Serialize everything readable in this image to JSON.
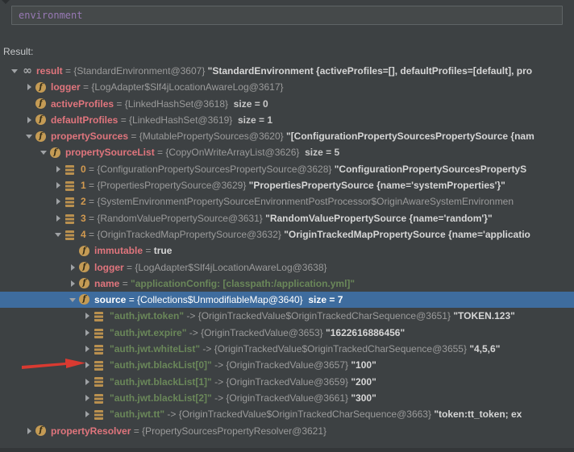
{
  "expression_bar": {
    "value": "environment"
  },
  "result_label": "Result:",
  "colors": {
    "background": "#3d4143",
    "selection_blue": "#3e6c9e",
    "variable_name_red": "#e0757d",
    "reference_gray": "#9b9b9b",
    "value_white": "#d6d6d6",
    "string_green": "#6a8759",
    "index_gold": "#d29a50",
    "field_icon_gold": "#c49b55",
    "array_icon_tan": "#b9904f",
    "annotation_arrow_red": "#d93a31",
    "input_text_purple": "#9879b5"
  },
  "annotation": {
    "type": "red-arrow",
    "points_at": "auth.jwt.blackList[0] row"
  },
  "tree": {
    "rows": [
      {
        "level": 0,
        "expander": "down",
        "icon": "watch",
        "selected": false,
        "segments": [
          {
            "s": "name",
            "t": "result"
          },
          {
            "s": "ref",
            "t": " = {StandardEnvironment@3607} "
          },
          {
            "s": "value",
            "t": "\"StandardEnvironment {activeProfiles=[], defaultProfiles=[default], pro"
          }
        ]
      },
      {
        "level": 1,
        "expander": "right",
        "icon": "field",
        "selected": false,
        "segments": [
          {
            "s": "name",
            "t": "logger"
          },
          {
            "s": "ref",
            "t": " = {LogAdapter$Slf4jLocationAwareLog@3617}"
          }
        ]
      },
      {
        "level": 1,
        "expander": null,
        "icon": "field",
        "selected": false,
        "segments": [
          {
            "s": "name",
            "t": "activeProfiles"
          },
          {
            "s": "ref",
            "t": " = {LinkedHashSet@3618}"
          },
          {
            "s": "size",
            "t": "  size = 0"
          }
        ]
      },
      {
        "level": 1,
        "expander": "right",
        "icon": "field",
        "selected": false,
        "segments": [
          {
            "s": "name",
            "t": "defaultProfiles"
          },
          {
            "s": "ref",
            "t": " = {LinkedHashSet@3619}"
          },
          {
            "s": "size",
            "t": "  size = 1"
          }
        ]
      },
      {
        "level": 1,
        "expander": "down",
        "icon": "field",
        "selected": false,
        "segments": [
          {
            "s": "name",
            "t": "propertySources"
          },
          {
            "s": "ref",
            "t": " = {MutablePropertySources@3620} "
          },
          {
            "s": "value",
            "t": "\"[ConfigurationPropertySourcesPropertySource {nam"
          }
        ]
      },
      {
        "level": 2,
        "expander": "down",
        "icon": "field",
        "selected": false,
        "segments": [
          {
            "s": "name",
            "t": "propertySourceList"
          },
          {
            "s": "ref",
            "t": " = {CopyOnWriteArrayList@3626}"
          },
          {
            "s": "size",
            "t": "  size = 5"
          }
        ]
      },
      {
        "level": 3,
        "expander": "right",
        "icon": "array",
        "selected": false,
        "segments": [
          {
            "s": "index",
            "t": "0"
          },
          {
            "s": "ref",
            "t": " = {ConfigurationPropertySourcesPropertySource@3628} "
          },
          {
            "s": "value",
            "t": "\"ConfigurationPropertySourcesPropertyS"
          }
        ]
      },
      {
        "level": 3,
        "expander": "right",
        "icon": "array",
        "selected": false,
        "segments": [
          {
            "s": "index",
            "t": "1"
          },
          {
            "s": "ref",
            "t": " = {PropertiesPropertySource@3629} "
          },
          {
            "s": "value",
            "t": "\"PropertiesPropertySource {name='systemProperties'}\""
          }
        ]
      },
      {
        "level": 3,
        "expander": "right",
        "icon": "array",
        "selected": false,
        "segments": [
          {
            "s": "index",
            "t": "2"
          },
          {
            "s": "ref",
            "t": " = {SystemEnvironmentPropertySourceEnvironmentPostProcessor$OriginAwareSystemEnvironmen"
          }
        ]
      },
      {
        "level": 3,
        "expander": "right",
        "icon": "array",
        "selected": false,
        "segments": [
          {
            "s": "index",
            "t": "3"
          },
          {
            "s": "ref",
            "t": " = {RandomValuePropertySource@3631} "
          },
          {
            "s": "value",
            "t": "\"RandomValuePropertySource {name='random'}\""
          }
        ]
      },
      {
        "level": 3,
        "expander": "down",
        "icon": "array",
        "selected": false,
        "segments": [
          {
            "s": "index",
            "t": "4"
          },
          {
            "s": "ref",
            "t": " = {OriginTrackedMapPropertySource@3632} "
          },
          {
            "s": "value",
            "t": "\"OriginTrackedMapPropertySource {name='applicatio"
          }
        ]
      },
      {
        "level": 4,
        "expander": null,
        "icon": "field",
        "selected": false,
        "segments": [
          {
            "s": "name",
            "t": "immutable"
          },
          {
            "s": "ref",
            "t": " = "
          },
          {
            "s": "value",
            "t": "true"
          }
        ]
      },
      {
        "level": 4,
        "expander": "right",
        "icon": "field",
        "selected": false,
        "segments": [
          {
            "s": "name",
            "t": "logger"
          },
          {
            "s": "ref",
            "t": " = {LogAdapter$Slf4jLocationAwareLog@3638}"
          }
        ]
      },
      {
        "level": 4,
        "expander": "right",
        "icon": "field",
        "selected": false,
        "segments": [
          {
            "s": "name",
            "t": "name"
          },
          {
            "s": "ref",
            "t": " = "
          },
          {
            "s": "string",
            "t": "\"applicationConfig: [classpath:/application.yml]\""
          }
        ]
      },
      {
        "level": 4,
        "expander": "down",
        "icon": "field",
        "selected": true,
        "segments": [
          {
            "s": "name",
            "t": "source"
          },
          {
            "s": "ref",
            "t": " = {Collections$UnmodifiableMap@3640}"
          },
          {
            "s": "size",
            "t": "  size = 7"
          }
        ]
      },
      {
        "level": 5,
        "expander": "right",
        "icon": "array",
        "selected": false,
        "segments": [
          {
            "s": "string",
            "t": "\"auth.jwt.token\""
          },
          {
            "s": "ref",
            "t": " -> {OriginTrackedValue$OriginTrackedCharSequence@3651} "
          },
          {
            "s": "value",
            "t": "\"TOKEN.123\""
          }
        ]
      },
      {
        "level": 5,
        "expander": "right",
        "icon": "array",
        "selected": false,
        "segments": [
          {
            "s": "string",
            "t": "\"auth.jwt.expire\""
          },
          {
            "s": "ref",
            "t": " -> {OriginTrackedValue@3653} "
          },
          {
            "s": "value",
            "t": "\"1622616886456\""
          }
        ]
      },
      {
        "level": 5,
        "expander": "right",
        "icon": "array",
        "selected": false,
        "segments": [
          {
            "s": "string",
            "t": "\"auth.jwt.whiteList\""
          },
          {
            "s": "ref",
            "t": " -> {OriginTrackedValue$OriginTrackedCharSequence@3655} "
          },
          {
            "s": "value",
            "t": "\"4,5,6\""
          }
        ]
      },
      {
        "level": 5,
        "expander": "right",
        "icon": "array",
        "selected": false,
        "arrow": true,
        "segments": [
          {
            "s": "string",
            "t": "\"auth.jwt.blackList[0]\""
          },
          {
            "s": "ref",
            "t": " -> {OriginTrackedValue@3657} "
          },
          {
            "s": "value",
            "t": "\"100\""
          }
        ]
      },
      {
        "level": 5,
        "expander": "right",
        "icon": "array",
        "selected": false,
        "segments": [
          {
            "s": "string",
            "t": "\"auth.jwt.blackList[1]\""
          },
          {
            "s": "ref",
            "t": " -> {OriginTrackedValue@3659} "
          },
          {
            "s": "value",
            "t": "\"200\""
          }
        ]
      },
      {
        "level": 5,
        "expander": "right",
        "icon": "array",
        "selected": false,
        "segments": [
          {
            "s": "string",
            "t": "\"auth.jwt.blackList[2]\""
          },
          {
            "s": "ref",
            "t": " -> {OriginTrackedValue@3661} "
          },
          {
            "s": "value",
            "t": "\"300\""
          }
        ]
      },
      {
        "level": 5,
        "expander": "right",
        "icon": "array",
        "selected": false,
        "segments": [
          {
            "s": "string",
            "t": "\"auth.jwt.tt\""
          },
          {
            "s": "ref",
            "t": " -> {OriginTrackedValue$OriginTrackedCharSequence@3663} "
          },
          {
            "s": "value",
            "t": "\"token:tt_token; ex"
          }
        ]
      },
      {
        "level": 1,
        "expander": "right",
        "icon": "field",
        "selected": false,
        "segments": [
          {
            "s": "name",
            "t": "propertyResolver"
          },
          {
            "s": "ref",
            "t": " = {PropertySourcesPropertyResolver@3621}"
          }
        ]
      }
    ]
  }
}
